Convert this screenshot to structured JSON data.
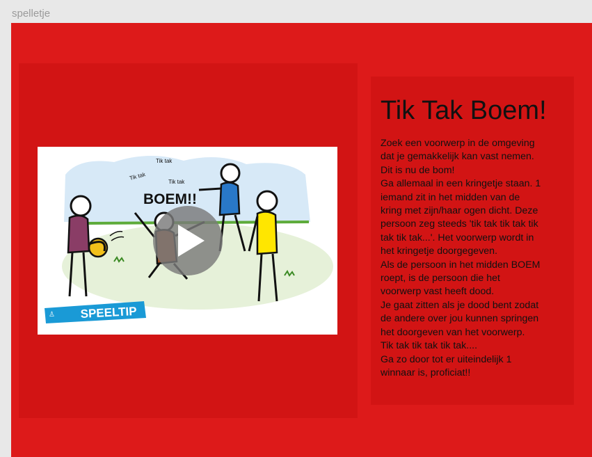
{
  "window": {
    "title": "spelletje"
  },
  "video": {
    "thumbnail_texts": {
      "tik1": "Tik tak",
      "tik2": "Tik tak",
      "tik3": "Tik tak",
      "boom": "BOEM!!",
      "banner": "SPEELTIP"
    },
    "play_icon": "play-icon",
    "colors": {
      "sky": "#d7e9f7",
      "grass": "#e6f1d9",
      "banner": "#1a9ad6",
      "play_overlay": "#7a7a7a"
    }
  },
  "game": {
    "title": "Tik Tak Boem!",
    "lines": [
      "Zoek een voorwerp in de omgeving",
      "dat je gemakkelijk kan vast nemen.",
      "Dit is nu de bom!",
      "Ga allemaal in een kringetje staan. 1",
      "iemand zit in het midden van de",
      "kring met zijn/haar ogen dicht. Deze",
      "persoon zeg steeds 'tik tak tik tak tik",
      "tak tik tak...'. Het voorwerp wordt in",
      "het kringetje doorgegeven.",
      "Als de persoon in het midden BOEM",
      "roept, is de persoon die het",
      "voorwerp vast heeft dood.",
      "Je gaat zitten als je dood bent zodat",
      "de andere over jou kunnen springen",
      "het doorgeven van het voorwerp.",
      "Tik tak tik tak tik tak....",
      "Ga zo door tot er uiteindelijk 1",
      "winnaar is, proficiat!!"
    ]
  },
  "colors": {
    "page_background": "#dd1a1a",
    "panel_background": "#d21414",
    "text": "#111111"
  }
}
